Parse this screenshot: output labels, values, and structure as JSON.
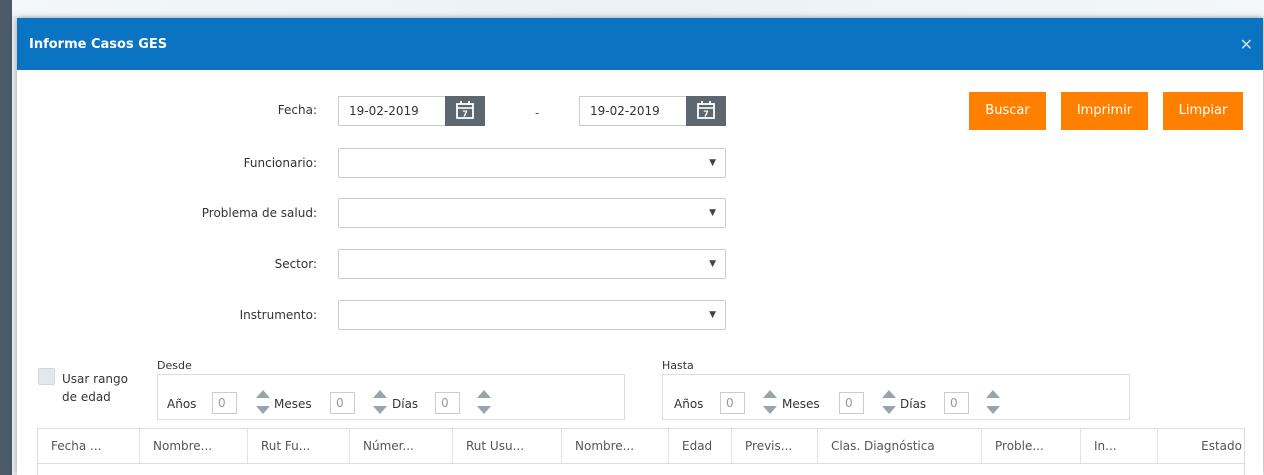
{
  "window": {
    "title": "Informe Casos GES"
  },
  "form": {
    "fecha_label": "Fecha:",
    "fecha_desde": "19-02-2019",
    "fecha_separator": "-",
    "fecha_hasta": "19-02-2019",
    "calendar_glyph": "7",
    "funcionario_label": "Funcionario:",
    "problema_label": "Problema de salud:",
    "sector_label": "Sector:",
    "instrumento_label": "Instrumento:"
  },
  "buttons": {
    "buscar": "Buscar",
    "imprimir": "Imprimir",
    "limpiar": "Limpiar"
  },
  "age_range": {
    "checkbox_label": "Usar rango de edad",
    "desde_label": "Desde",
    "hasta_label": "Hasta",
    "anos_label": "Años",
    "meses_label": "Meses",
    "dias_label": "Días",
    "desde": {
      "anos": "0",
      "meses": "0",
      "dias": "0"
    },
    "hasta": {
      "anos": "0",
      "meses": "0",
      "dias": "0"
    }
  },
  "table": {
    "columns": [
      "Fecha ...",
      "Nombre...",
      "Rut Fu...",
      "Númer...",
      "Rut Usu...",
      "Nombre...",
      "Edad",
      "Previs...",
      "Clas. Diagnóstica",
      "Proble...",
      "In...",
      "Estado"
    ]
  },
  "icons": {
    "close": "close-icon",
    "calendar": "calendar-icon",
    "dropdown": "chevron-down-icon"
  },
  "colors": {
    "header": "#0a73c2",
    "accent_button": "#ff8000",
    "calendar_button": "#5c6770"
  }
}
